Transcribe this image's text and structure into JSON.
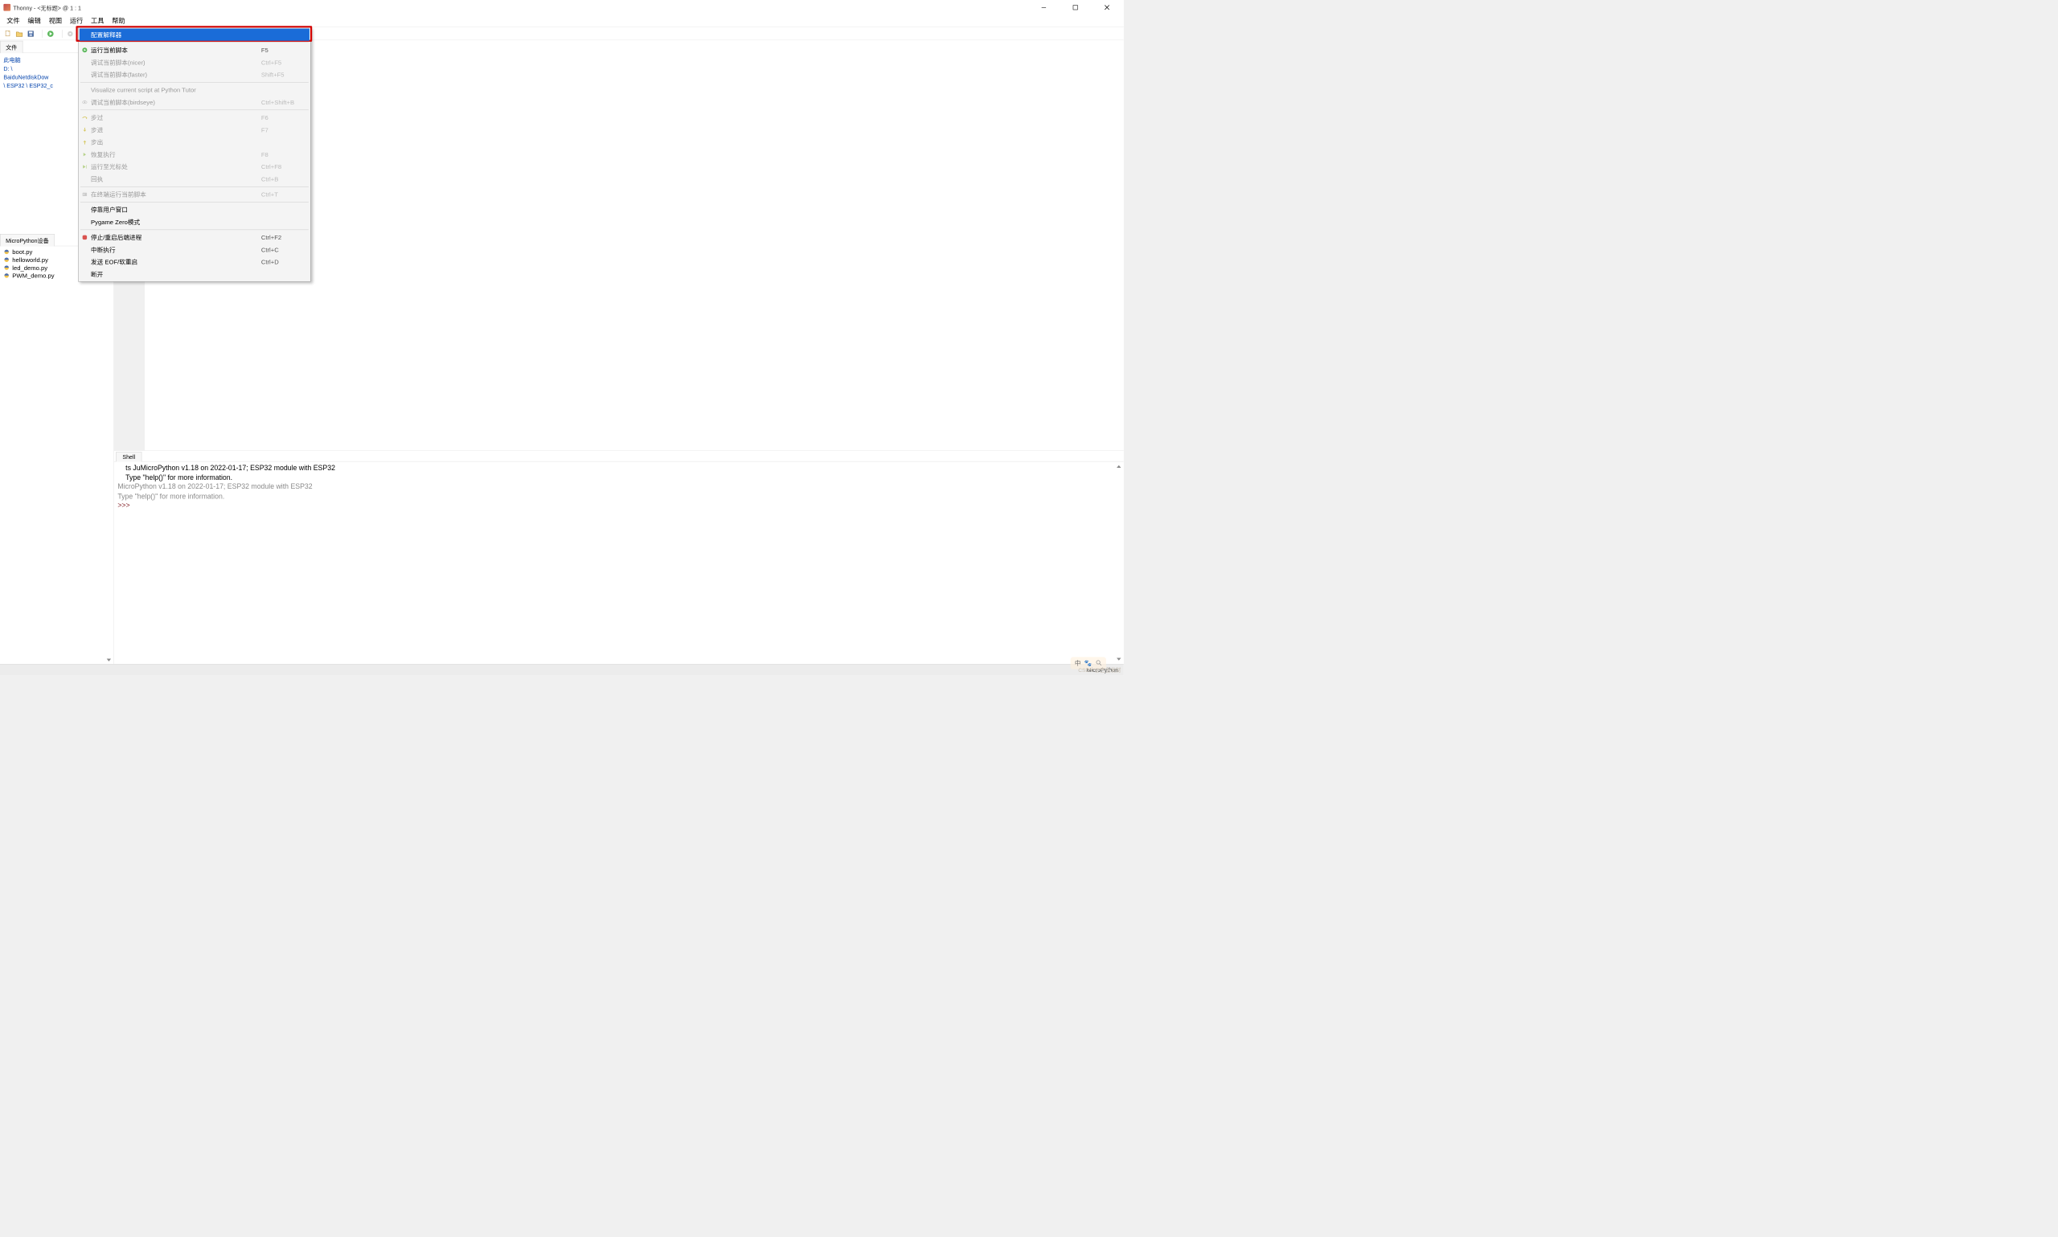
{
  "title": "Thonny  -  <无标题>  @  1 : 1",
  "window_controls": {
    "min": "—",
    "max": "▢",
    "close": "✕"
  },
  "menubar": [
    "文件",
    "编辑",
    "视图",
    "运行",
    "工具",
    "帮助"
  ],
  "sidebar": {
    "files_tab": "文件",
    "paths": [
      "此电脑",
      "D: \\",
      "BaiduNetdiskDow",
      "\\ ESP32 \\ ESP32_c"
    ],
    "device_tab": "MicroPython设备",
    "files": [
      "boot.py",
      "helloworld.py",
      "led_demo.py",
      "PWM_demo.py"
    ]
  },
  "dropdown": {
    "items": [
      {
        "label": "配置解释器",
        "shortcut": "",
        "type": "highlight"
      },
      {
        "type": "sep"
      },
      {
        "label": "运行当前脚本",
        "shortcut": "F5",
        "icon": "play"
      },
      {
        "label": "调试当前脚本(nicer)",
        "shortcut": "Ctrl+F5",
        "disabled": true
      },
      {
        "label": "调试当前脚本(faster)",
        "shortcut": "Shift+F5",
        "disabled": true
      },
      {
        "type": "sep"
      },
      {
        "label": "Visualize current script at Python Tutor",
        "shortcut": "",
        "disabled": true
      },
      {
        "label": "调试当前脚本(birdseye)",
        "shortcut": "Ctrl+Shift+B",
        "disabled": true
      },
      {
        "type": "sep"
      },
      {
        "label": "步过",
        "shortcut": "F6",
        "disabled": true
      },
      {
        "label": "步进",
        "shortcut": "F7",
        "disabled": true
      },
      {
        "label": "步出",
        "shortcut": "",
        "disabled": true
      },
      {
        "label": "恢复执行",
        "shortcut": "F8",
        "disabled": true
      },
      {
        "label": "运行至光标处",
        "shortcut": "Ctrl+F8",
        "disabled": true
      },
      {
        "label": "回执",
        "shortcut": "Ctrl+B",
        "disabled": true
      },
      {
        "type": "sep"
      },
      {
        "label": "在终端运行当前脚本",
        "shortcut": "Ctrl+T",
        "disabled": true
      },
      {
        "type": "sep"
      },
      {
        "label": "停靠用户窗口",
        "shortcut": ""
      },
      {
        "label": "Pygame Zero模式",
        "shortcut": ""
      },
      {
        "type": "sep"
      },
      {
        "label": "停止/重启后端进程",
        "shortcut": "Ctrl+F2",
        "icon": "stop"
      },
      {
        "label": "中断执行",
        "shortcut": "Ctrl+C"
      },
      {
        "label": "发送 EOF/软重启",
        "shortcut": "Ctrl+D"
      },
      {
        "label": "断开",
        "shortcut": ""
      }
    ]
  },
  "shell": {
    "tab": "Shell",
    "line1a": "ts JuMicroPython v1.18 on 2022-01-17; ESP32 module with ESP32",
    "line1b": "Type \"help()\" for more information.",
    "line2": "MicroPython v1.18 on 2022-01-17; ESP32 module with ESP32",
    "line3": "Type \"help()\" for more information.",
    "prompt": ">>> "
  },
  "statusbar": {
    "interpreter": "MicroPython"
  },
  "ime": {
    "lang": "中"
  },
  "watermark": "CSDN @古鱼发财"
}
